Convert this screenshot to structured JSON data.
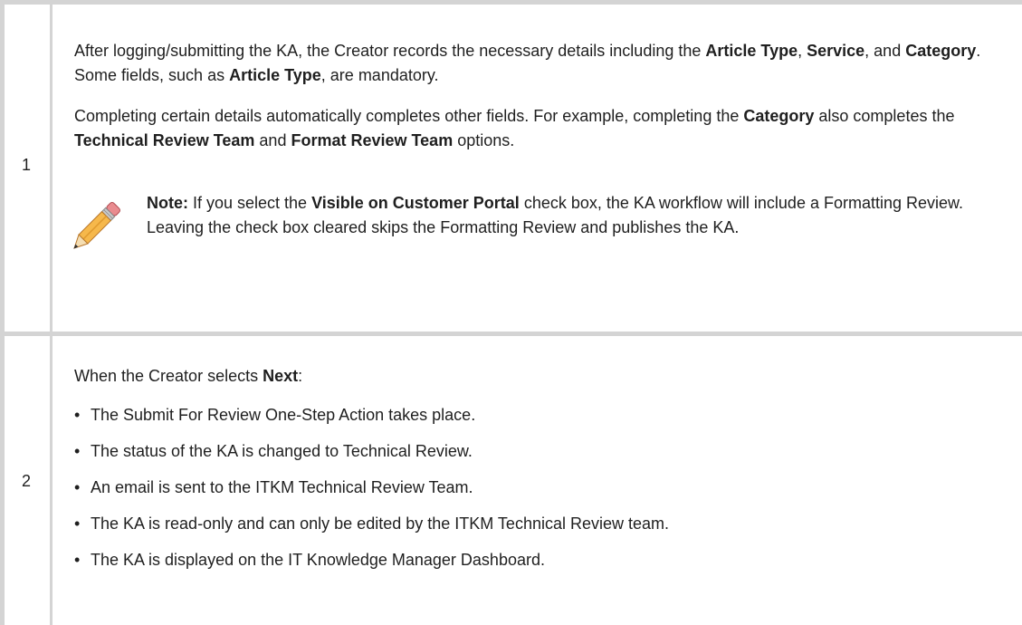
{
  "rows": [
    {
      "number": "1",
      "para1": {
        "t1": "After logging/submitting the KA, the Creator records the necessary details including the ",
        "b1": "Article Type",
        "t2": ", ",
        "b2": "Service",
        "t3": ", and ",
        "b3": "Category",
        "t4": ". Some fields, such as ",
        "b4": "Article Type",
        "t5": ", are mandatory."
      },
      "para2": {
        "t1": "Completing certain details automatically completes other fields. For example, completing the ",
        "b1": "Category",
        "t2": " also completes the ",
        "b2": "Technical Review Team",
        "t3": " and ",
        "b3": "Format Review Team",
        "t4": " options."
      },
      "note": {
        "icon": "pencil-icon",
        "label": "Note:",
        "t1": " If you select the ",
        "b1": "Visible on Customer Portal",
        "t2": " check box, the KA workflow will include a Formatting Review. Leaving the check box cleared skips the Formatting Review and publishes the KA."
      }
    },
    {
      "number": "2",
      "intro": {
        "t1": "When the Creator selects ",
        "b1": "Next",
        "t2": ":"
      },
      "bullets": [
        "The Submit For Review One-Step Action takes place.",
        "The status of the KA is changed to Technical Review.",
        "An email is sent to the ITKM Technical Review Team.",
        "The KA is read-only and can only be edited by the ITKM Technical Review team.",
        "The KA is displayed on the IT Knowledge Manager Dashboard."
      ]
    }
  ]
}
